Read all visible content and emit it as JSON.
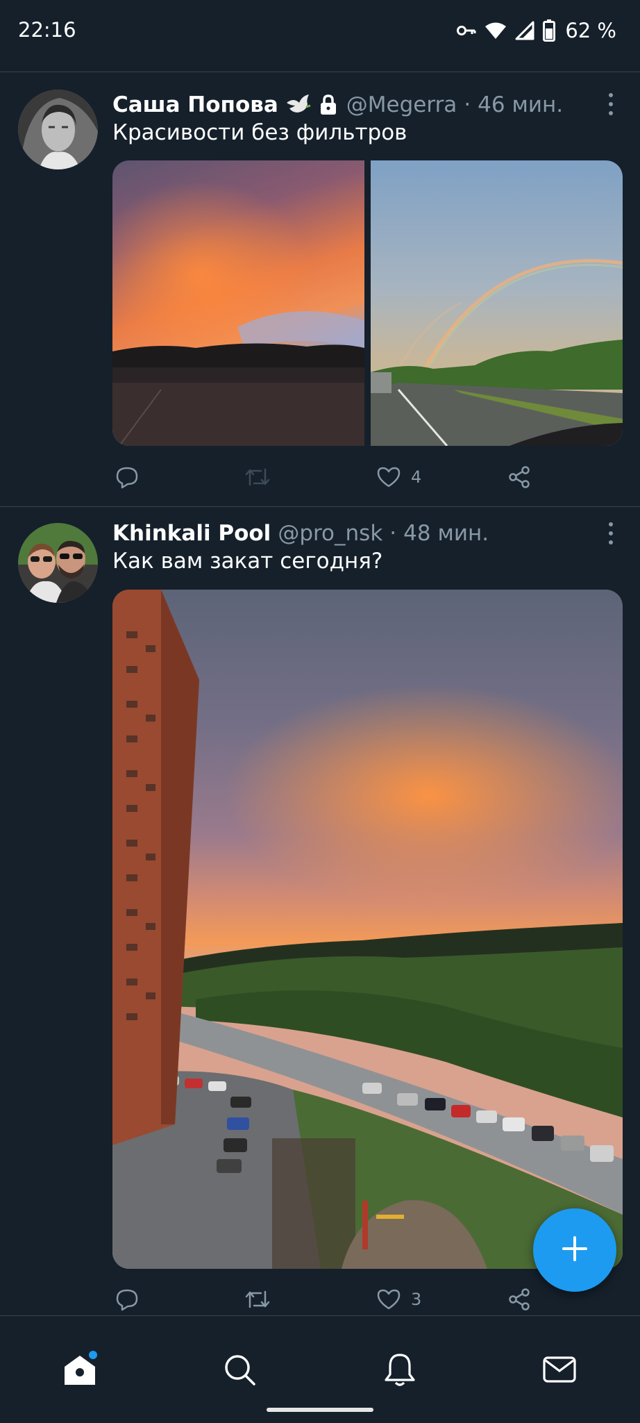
{
  "status_bar": {
    "time": "22:16",
    "battery": "62 %",
    "icons": [
      "vpn-key-icon",
      "wifi-icon",
      "signal-icon",
      "battery-icon"
    ]
  },
  "tweets": [
    {
      "display_name": "Саша Попова",
      "badges": [
        "dove-icon",
        "lock-icon"
      ],
      "handle": "@Megerra",
      "time": "46 мин.",
      "text": "Красивости без фильтров",
      "media": [
        "sunset-photo",
        "rainbow-photo"
      ],
      "stats": {
        "replies": "",
        "retweets": "",
        "likes": "4"
      }
    },
    {
      "display_name": "Khinkali Pool",
      "handle": "@pro_nsk",
      "time": "48 мин.",
      "text": "Как вам закат сегодня?",
      "media": [
        "sunset-over-building-photo"
      ],
      "stats": {
        "replies": "",
        "retweets": "",
        "likes": "3"
      }
    }
  ],
  "separator": "·",
  "bottom_nav": [
    "home-icon",
    "search-icon",
    "notifications-icon",
    "messages-icon"
  ],
  "colors": {
    "background": "#15202b",
    "accent": "#1d9bf0",
    "muted": "#8899a6",
    "divider": "#38444d"
  }
}
